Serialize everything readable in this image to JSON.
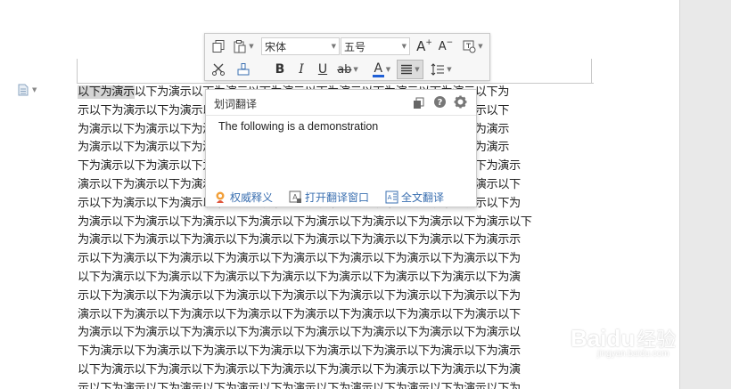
{
  "document": {
    "phrase": "以下为演示",
    "lines": [
      "以下为演示以下为演示以下为演示以下为演示以下为演示以下为演示以下为演示以下为",
      "示以下为演示以下为演示以下为演示以下为演示以下为演示以下为演示以下为演示以下",
      "为演示以下为演示以下为演示以下为演示以下为演示以下为演示以下为演示以下为演示",
      "为演示以下为演示以下为演示以下为演示以下为演示以下为演示以下为演示以下为演示",
      "下为演示以下为演示以下为演示以下为演示以下为演示以下为演示以下为演示以下为演示",
      "演示以下为演示以下为演示以下为演示以下为演示以下为演示以下为演示以下为演示以下",
      "示以下为演示以下为演示以下为演示以下为演示以下为演示以下为演示以下为演示以下为",
      "为演示以下为演示以下为演示以下为演示以下为演示以下为演示以下为演示以下为演示以下",
      "为演示以下为演示以下为演示以下为演示以下为演示以下为演示以下为演示以下为演示示",
      "示以下为演示以下为演示以下为演示以下为演示以下为演示以下为演示以下为演示以下为",
      "以下为演示以下为演示以下为演示以下为演示以下为演示以下为演示以下为演示以下为演",
      "示以下为演示以下为演示以下为演示以下为演示以下为演示以下为演示以下为演示以下为",
      "演示以下为演示以下为演示以下为演示以下为演示以下为演示以下为演示以下为演示以下",
      "为演示以下为演示以下为演示以下为演示以下为演示以下为演示以下为演示以下为演示以",
      "下为演示以下为演示以下为演示以下为演示以下为演示以下为演示以下为演示以下为演示",
      "以下为演示以下为演示以下为演示以下为演示以下为演示以下为演示以下为演示以下为演",
      "示以下为演示以下为演示以下为演示以下为演示以下为演示以下为演示以下为演示以下为"
    ]
  },
  "toolbar": {
    "font_name": "宋体",
    "font_size": "五号",
    "bold": "B",
    "italic": "I",
    "underline": "U",
    "strike": "ab",
    "font_color_letter": "A",
    "grow_font": "A",
    "shrink_font": "A"
  },
  "translation": {
    "title": "划词翻译",
    "result": "The following is a demonstration",
    "link_authority": "权威释义",
    "link_open_window": "打开翻译窗口",
    "link_full_text": "全文翻译"
  },
  "colors": {
    "link": "#3a6fb0",
    "font_color_bar": "#1f5fd6",
    "highlight": "#d4d4d4"
  },
  "watermark": {
    "brand": "Baidu",
    "brand_cn": "经验",
    "url": "jingyan.baidu.com"
  }
}
